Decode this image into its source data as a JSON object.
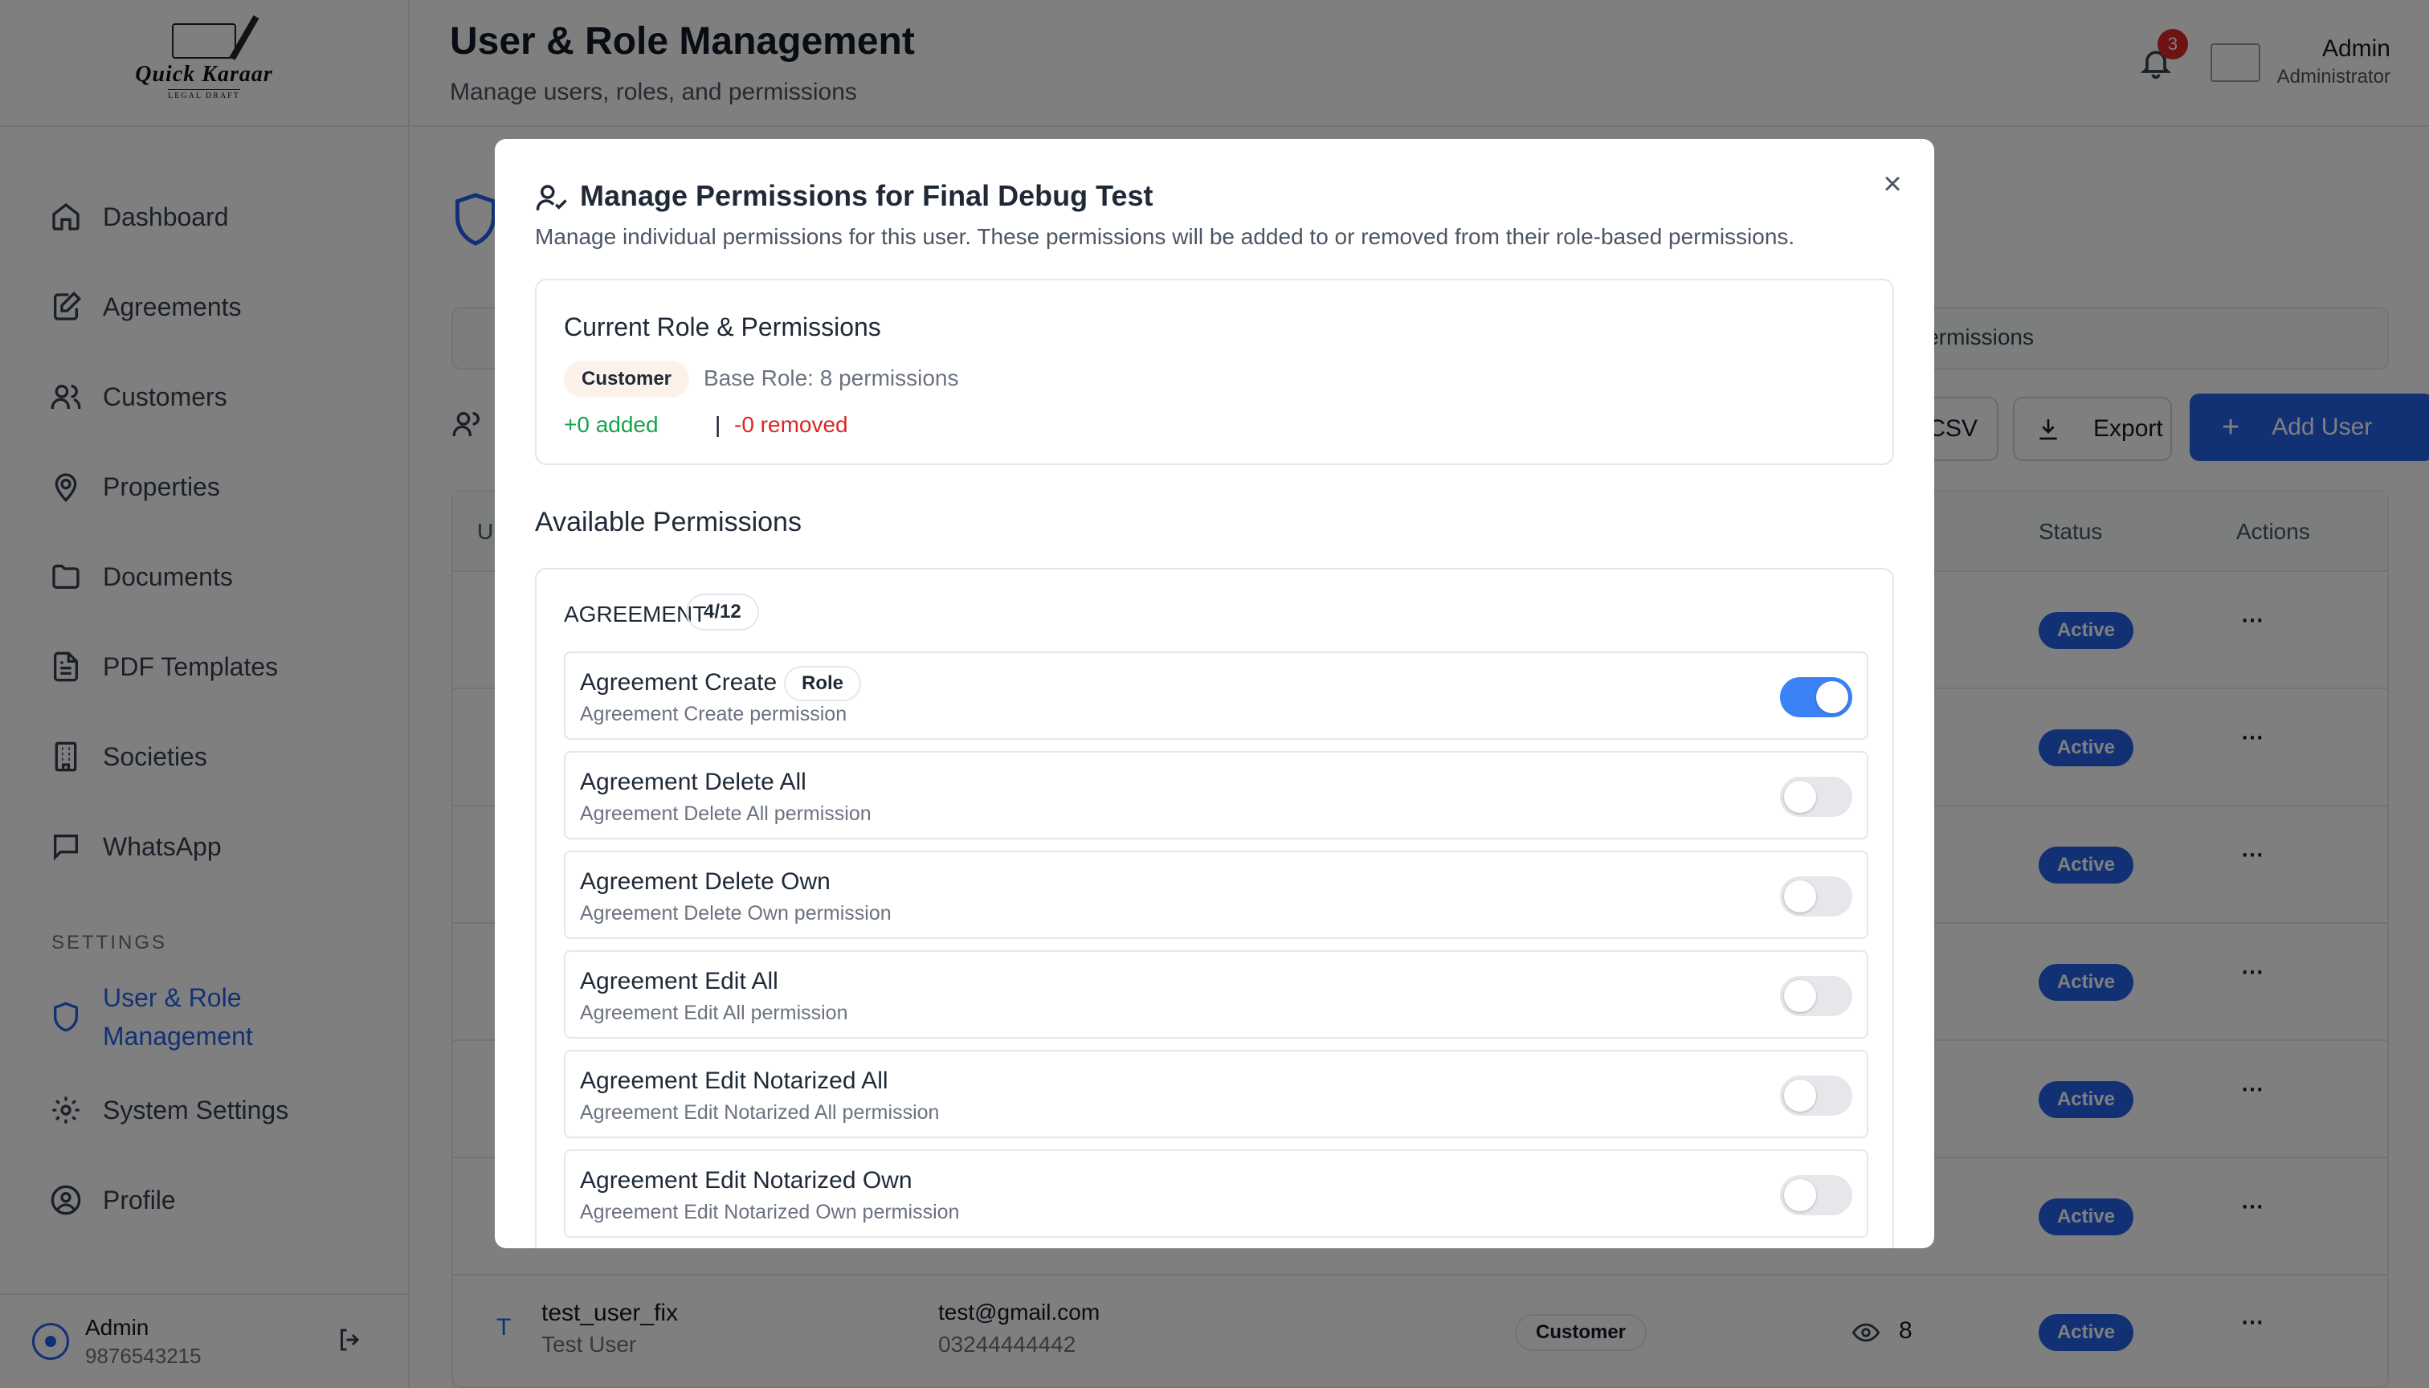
{
  "sidebar": {
    "logo_text": "Quick Karaar",
    "logo_sub": "LEGAL DRAFT",
    "items": [
      {
        "label": "Dashboard",
        "icon": "home-icon"
      },
      {
        "label": "Agreements",
        "icon": "edit-document-icon"
      },
      {
        "label": "Customers",
        "icon": "users-icon"
      },
      {
        "label": "Properties",
        "icon": "map-pin-icon"
      },
      {
        "label": "Documents",
        "icon": "folder-icon"
      },
      {
        "label": "PDF Templates",
        "icon": "file-text-icon"
      },
      {
        "label": "Societies",
        "icon": "building-icon"
      },
      {
        "label": "WhatsApp",
        "icon": "message-icon"
      }
    ],
    "settings_label": "SETTINGS",
    "settings_items": [
      {
        "label": "User & Role Management",
        "icon": "shield-icon",
        "active": true
      },
      {
        "label": "System Settings",
        "icon": "gear-icon"
      },
      {
        "label": "Profile",
        "icon": "user-circle-icon"
      }
    ],
    "footer": {
      "name": "Admin",
      "phone": "9876543215"
    }
  },
  "header": {
    "title": "User & Role Management",
    "subtitle": "Manage users, roles, and permissions",
    "notification_count": "3",
    "user_name": "Admin",
    "user_role": "Administrator"
  },
  "main": {
    "tab_permissions": "Permissions",
    "buttons": {
      "csv": "CSV",
      "export": "Export",
      "add_user": "Add User"
    },
    "table_headers": {
      "first": "U",
      "status": "Status",
      "actions": "Actions"
    },
    "rows_status": [
      "Active",
      "Active",
      "Active",
      "Active",
      "Active",
      "Active",
      "Active"
    ],
    "last_row": {
      "initial": "T",
      "username": "test_user_fix",
      "fullname": "Test User",
      "email": "test@gmail.com",
      "phone": "03244444442",
      "role": "Customer",
      "perm_count": "8",
      "status": "Active"
    }
  },
  "modal": {
    "title": "Manage Permissions for Final Debug Test",
    "description": "Manage individual permissions for this user. These permissions will be added to or removed from their role-based permissions.",
    "current": {
      "title": "Current Role & Permissions",
      "role_badge": "Customer",
      "base_role": "Base Role: 8 permissions",
      "added": "+0 added",
      "separator": "|",
      "removed": "-0 removed"
    },
    "available_title": "Available Permissions",
    "category": {
      "name": "AGREEMENT",
      "count": "4/12"
    },
    "permissions": [
      {
        "name": "Agreement Create",
        "desc": "Agreement Create permission",
        "role_tag": "Role",
        "enabled": true
      },
      {
        "name": "Agreement Delete All",
        "desc": "Agreement Delete All permission",
        "enabled": false
      },
      {
        "name": "Agreement Delete Own",
        "desc": "Agreement Delete Own permission",
        "enabled": false
      },
      {
        "name": "Agreement Edit All",
        "desc": "Agreement Edit All permission",
        "enabled": false
      },
      {
        "name": "Agreement Edit Notarized All",
        "desc": "Agreement Edit Notarized All permission",
        "enabled": false
      },
      {
        "name": "Agreement Edit Notarized Own",
        "desc": "Agreement Edit Notarized Own permission",
        "enabled": false
      }
    ]
  },
  "colors": {
    "accent": "#2563eb",
    "toggle_on": "#3b82f6",
    "added": "#16a34a",
    "removed": "#dc2626"
  }
}
